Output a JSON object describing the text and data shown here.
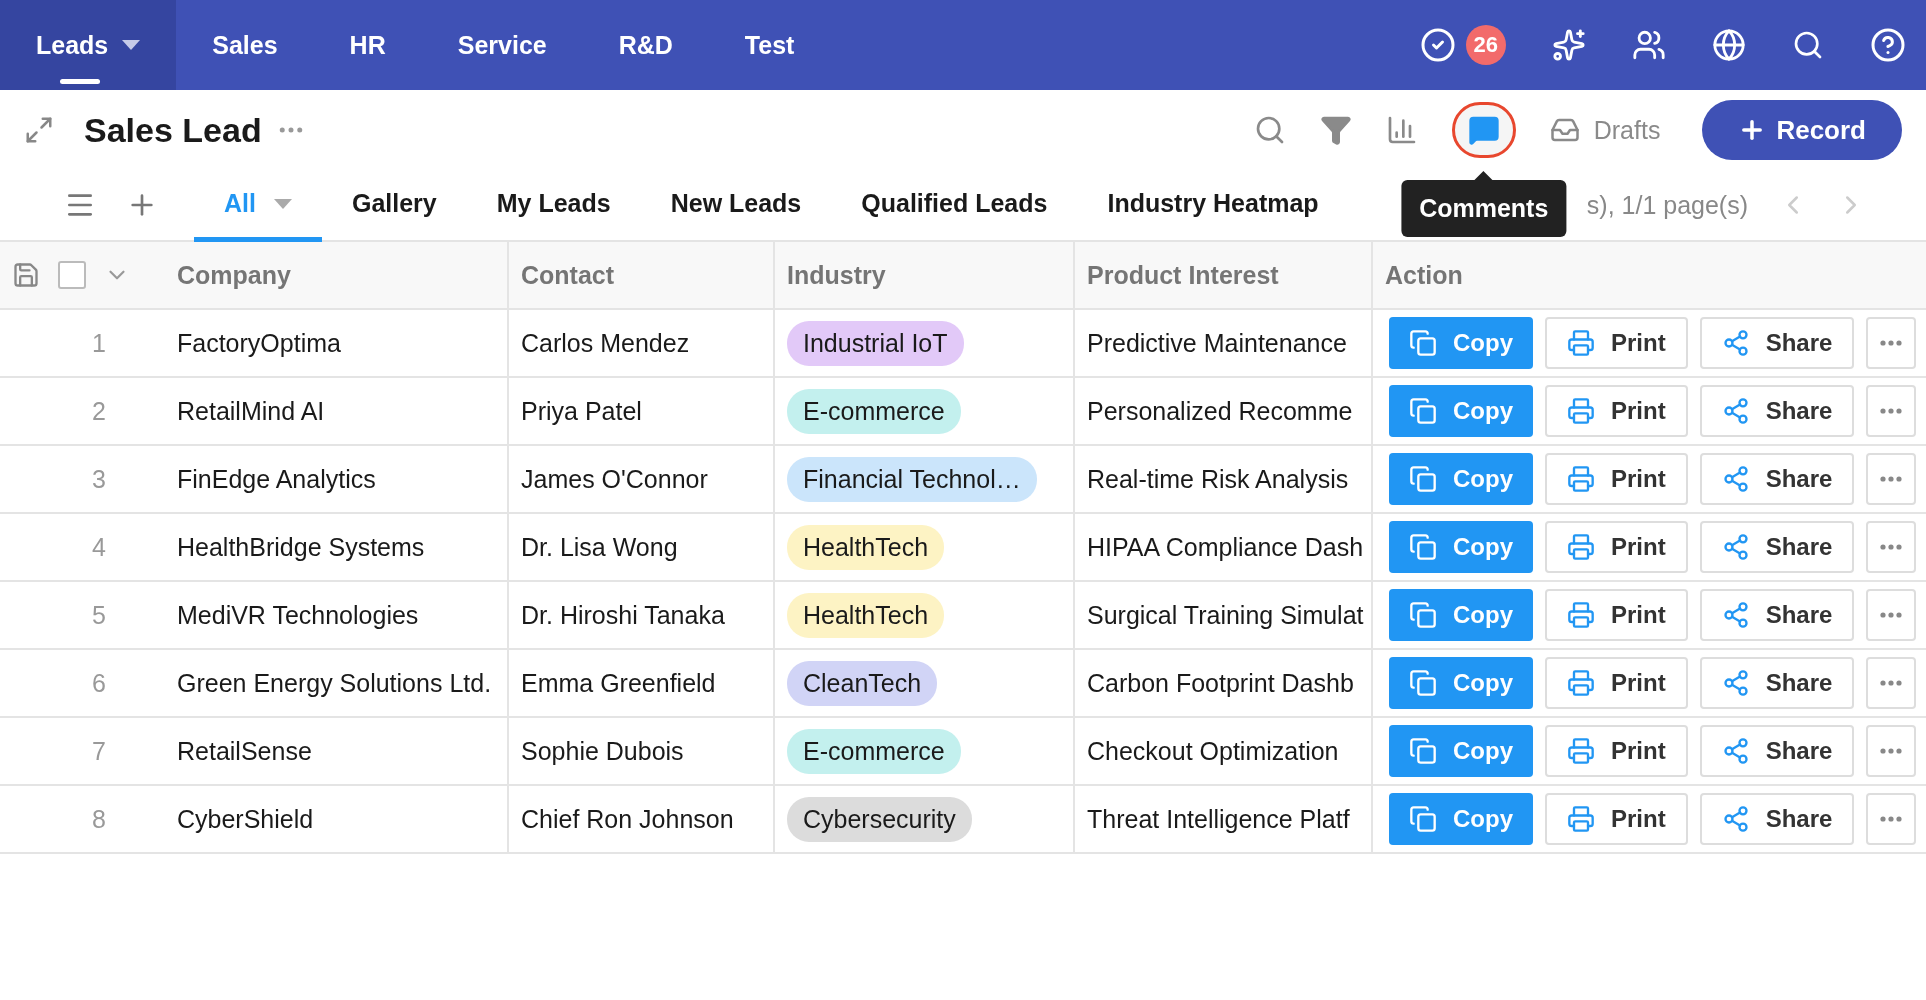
{
  "nav": {
    "tabs": [
      {
        "label": "Leads",
        "selected": true,
        "dropdown": true
      },
      {
        "label": "Sales",
        "selected": false,
        "dropdown": false
      },
      {
        "label": "HR",
        "selected": false,
        "dropdown": false
      },
      {
        "label": "Service",
        "selected": false,
        "dropdown": false
      },
      {
        "label": "R&D",
        "selected": false,
        "dropdown": false
      },
      {
        "label": "Test",
        "selected": false,
        "dropdown": false
      }
    ],
    "badge": "26"
  },
  "header": {
    "title": "Sales Lead",
    "tools": [
      {
        "kind": "search",
        "highlighted": false
      },
      {
        "kind": "filter",
        "highlighted": false
      },
      {
        "kind": "chart",
        "highlighted": false
      },
      {
        "kind": "comments",
        "highlighted": true
      }
    ],
    "drafts": "Drafts",
    "record_button": "Record",
    "tooltip": "Comments"
  },
  "views": {
    "tabs": [
      {
        "label": "All",
        "selected": true
      },
      {
        "label": "Gallery",
        "selected": false
      },
      {
        "label": "My Leads",
        "selected": false
      },
      {
        "label": "New Leads",
        "selected": false
      },
      {
        "label": "Qualified Leads",
        "selected": false
      },
      {
        "label": "Industry Heatmap",
        "selected": false
      }
    ],
    "pagination": "s), 1/1 page(s)"
  },
  "table": {
    "columns": [
      "Company",
      "Contact",
      "Industry",
      "Product Interest",
      "Action"
    ],
    "select_all_checked": false,
    "rows": [
      {
        "index": "1",
        "company": "FactoryOptima",
        "contact": "Carlos Mendez",
        "industry": "Industrial IoT",
        "color": "#e2c9f8",
        "product": "Predictive Maintenance",
        "actions": [
          "Copy",
          "Print",
          "Share"
        ]
      },
      {
        "index": "2",
        "company": "RetailMind AI",
        "contact": "Priya Patel",
        "industry": "E-commerce",
        "color": "#c3f0ee",
        "product": "Personalized Recomme",
        "actions": [
          "Copy",
          "Print",
          "Share"
        ]
      },
      {
        "index": "3",
        "company": "FinEdge Analytics",
        "contact": "James O'Connor",
        "industry": "Financial Technol…",
        "color": "#cbe5fb",
        "product": "Real-time Risk Analysis",
        "actions": [
          "Copy",
          "Print",
          "Share"
        ]
      },
      {
        "index": "4",
        "company": "HealthBridge Systems",
        "contact": "Dr. Lisa Wong",
        "industry": "HealthTech",
        "color": "#fdf3c4",
        "product": "HIPAA Compliance Dash",
        "actions": [
          "Copy",
          "Print",
          "Share"
        ]
      },
      {
        "index": "5",
        "company": "MediVR Technologies",
        "contact": "Dr. Hiroshi Tanaka",
        "industry": "HealthTech",
        "color": "#fdf3c4",
        "product": "Surgical Training Simulat",
        "actions": [
          "Copy",
          "Print",
          "Share"
        ]
      },
      {
        "index": "6",
        "company": "Green Energy Solutions Ltd.",
        "contact": "Emma Greenfield",
        "industry": "CleanTech",
        "color": "#d1d4f6",
        "product": "Carbon Footprint Dashb",
        "actions": [
          "Copy",
          "Print",
          "Share"
        ]
      },
      {
        "index": "7",
        "company": "RetailSense",
        "contact": "Sophie Dubois",
        "industry": "E-commerce",
        "color": "#c3f0ee",
        "product": "Checkout Optimization",
        "actions": [
          "Copy",
          "Print",
          "Share"
        ]
      },
      {
        "index": "8",
        "company": "CyberShield",
        "contact": "Chief Ron Johnson",
        "industry": "Cybersecurity",
        "color": "#dcdcdc",
        "product": "Threat Intelligence Platf",
        "actions": [
          "Copy",
          "Print",
          "Share"
        ]
      }
    ]
  }
}
